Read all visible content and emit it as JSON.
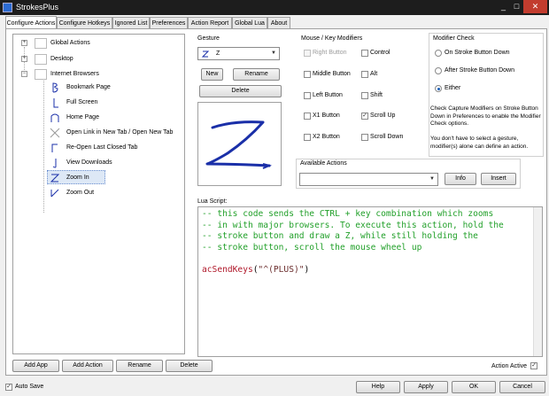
{
  "window": {
    "title": "StrokesPlus"
  },
  "tabs": [
    "Configure Actions",
    "Configure Hotkeys",
    "Ignored List",
    "Preferences",
    "Action Report",
    "Global Lua",
    "About"
  ],
  "tree": {
    "groups": [
      {
        "label": "Global Actions",
        "expander": "+"
      },
      {
        "label": "Desktop",
        "expander": "+"
      },
      {
        "label": "Internet Browsers",
        "expander": "−"
      }
    ],
    "actions": [
      "Bookmark Page",
      "Full Screen",
      "Home Page",
      "Open Link in New Tab / Open New Tab",
      "Re-Open Last Closed Tab",
      "View Downloads",
      "Zoom In",
      "Zoom Out"
    ],
    "selected": "Zoom In"
  },
  "buttons": {
    "add_app": "Add App",
    "add_action": "Add Action",
    "rename": "Rename",
    "delete": "Delete",
    "gesture_new": "New",
    "gesture_rename": "Rename",
    "gesture_delete": "Delete",
    "info": "Info",
    "insert": "Insert",
    "help": "Help",
    "apply": "Apply",
    "ok": "OK",
    "cancel": "Cancel"
  },
  "gesture": {
    "heading": "Gesture",
    "selected": "Z"
  },
  "modifiers": {
    "heading": "Mouse / Key Modifiers",
    "items": [
      {
        "label": "Right Button",
        "checked": false,
        "disabled": true
      },
      {
        "label": "Control",
        "checked": false,
        "disabled": false
      },
      {
        "label": "Middle Button",
        "checked": false,
        "disabled": false
      },
      {
        "label": "Alt",
        "checked": false,
        "disabled": false
      },
      {
        "label": "Left Button",
        "checked": false,
        "disabled": false
      },
      {
        "label": "Shift",
        "checked": false,
        "disabled": false
      },
      {
        "label": "X1 Button",
        "checked": false,
        "disabled": false
      },
      {
        "label": "Scroll Up",
        "checked": true,
        "disabled": false
      },
      {
        "label": "X2 Button",
        "checked": false,
        "disabled": false
      },
      {
        "label": "Scroll Down",
        "checked": false,
        "disabled": false
      }
    ]
  },
  "modifier_check": {
    "heading": "Modifier Check",
    "options": [
      "On Stroke Button Down",
      "After Stroke Button Down",
      "Either"
    ],
    "selected": "Either",
    "note1": "Check Capture Modifiers on Stroke Button Down in Preferences to enable the Modifier Check options.",
    "note2": "You don't have to select a gesture, modifier(s) alone can define an action."
  },
  "available_actions": {
    "heading": "Available Actions",
    "value": ""
  },
  "lua": {
    "heading": "Lua Script:",
    "comment_lines": [
      "-- this code sends the CTRL + key combination which zooms",
      "-- in with major browsers. To execute this action, hold the",
      "-- stroke button and draw a Z, while still holding the",
      "-- stroke button, scroll the mouse wheel up"
    ],
    "call_fn": "acSendKeys",
    "call_open": "(",
    "call_arg": "\"^(PLUS)\"",
    "call_close": ")"
  },
  "action_active": {
    "label": "Action Active",
    "checked": true
  },
  "auto_save": {
    "label": "Auto Save",
    "checked": true
  },
  "colors": {
    "accent": "#1c5fb8",
    "gesture_stroke": "#1a2fa8",
    "comment": "#22a02a"
  }
}
